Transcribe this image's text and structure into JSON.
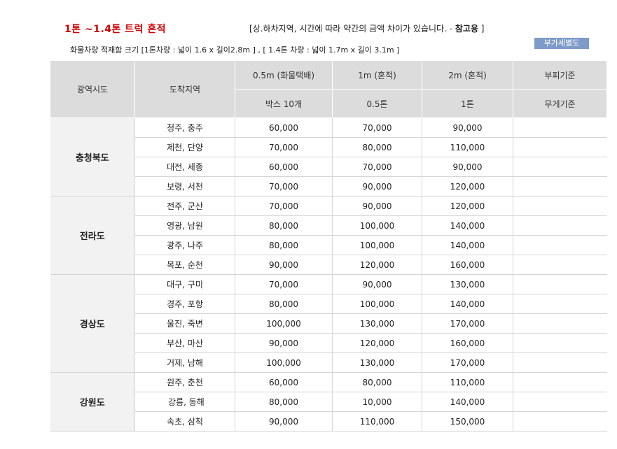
{
  "title": "1톤 ~1.4톤 트럭 혼적",
  "note_prefix": "[상.하차지역, 시간에 따라 약간의 금액 차이가 있습니다. - ",
  "note_bold": "참고용",
  "note_suffix": " ]",
  "extra_button": "부가세별도",
  "size_info": "화물차량 적재함 크기 [1톤차량 : 넓이 1.6 x  길이2.8m ] , [ 1.4톤 차량 : 넓이 1.7m x 길이 3.1m ]",
  "headers": {
    "province": "광역시도",
    "destination": "도착지역",
    "col1_top": "0.5m (화물택배)",
    "col2_top": "1m (혼적)",
    "col3_top": "2m (혼적)",
    "col4_top": "부피기준",
    "col1_bottom": "박스 10개",
    "col2_bottom": "0.5톤",
    "col3_bottom": "1톤",
    "col4_bottom": "무게기준"
  },
  "regions": [
    {
      "name": "충청북도",
      "rows": [
        {
          "dest": "청주, 충주",
          "p1": "60,000",
          "p2": "70,000",
          "p3": "90,000",
          "p4": ""
        },
        {
          "dest": "제천, 단양",
          "p1": "70,000",
          "p2": "80,000",
          "p3": "110,000",
          "p4": ""
        },
        {
          "dest": "대전, 세종",
          "p1": "60,000",
          "p2": "70,000",
          "p3": "90,000",
          "p4": ""
        },
        {
          "dest": "보령, 서천",
          "p1": "70,000",
          "p2": "90,000",
          "p3": "120,000",
          "p4": ""
        }
      ]
    },
    {
      "name": "전라도",
      "rows": [
        {
          "dest": "전주, 군산",
          "p1": "70,000",
          "p2": "90,000",
          "p3": "120,000",
          "p4": ""
        },
        {
          "dest": "영광, 남원",
          "p1": "80,000",
          "p2": "100,000",
          "p3": "140,000",
          "p4": ""
        },
        {
          "dest": "광주, 나주",
          "p1": "80,000",
          "p2": "100,000",
          "p3": "140,000",
          "p4": ""
        },
        {
          "dest": "목포, 순천",
          "p1": "90,000",
          "p2": "120,000",
          "p3": "160,000",
          "p4": ""
        }
      ]
    },
    {
      "name": "경상도",
      "rows": [
        {
          "dest": "대구, 구미",
          "p1": "70,000",
          "p2": "90,000",
          "p3": "130,000",
          "p4": ""
        },
        {
          "dest": "경주, 포항",
          "p1": "80,000",
          "p2": "100,000",
          "p3": "140,000",
          "p4": ""
        },
        {
          "dest": "울진, 죽변",
          "p1": "100,000",
          "p2": "130,000",
          "p3": "170,000",
          "p4": ""
        },
        {
          "dest": "부산, 마산",
          "p1": "90,000",
          "p2": "120,000",
          "p3": "160,000",
          "p4": ""
        },
        {
          "dest": "거제, 남해",
          "p1": "100,000",
          "p2": "130,000",
          "p3": "170,000",
          "p4": ""
        }
      ]
    },
    {
      "name": "강원도",
      "rows": [
        {
          "dest": "원주, 춘천",
          "p1": "60,000",
          "p2": "80,000",
          "p3": "110,000",
          "p4": ""
        },
        {
          "dest": " 강릉, 동해",
          "p1": "80,000",
          "p2": "10,000",
          "p3": "140,000",
          "p4": ""
        },
        {
          "dest": "속초, 삼척",
          "p1": "90,000",
          "p2": "110,000",
          "p3": "150,000",
          "p4": ""
        }
      ]
    }
  ]
}
